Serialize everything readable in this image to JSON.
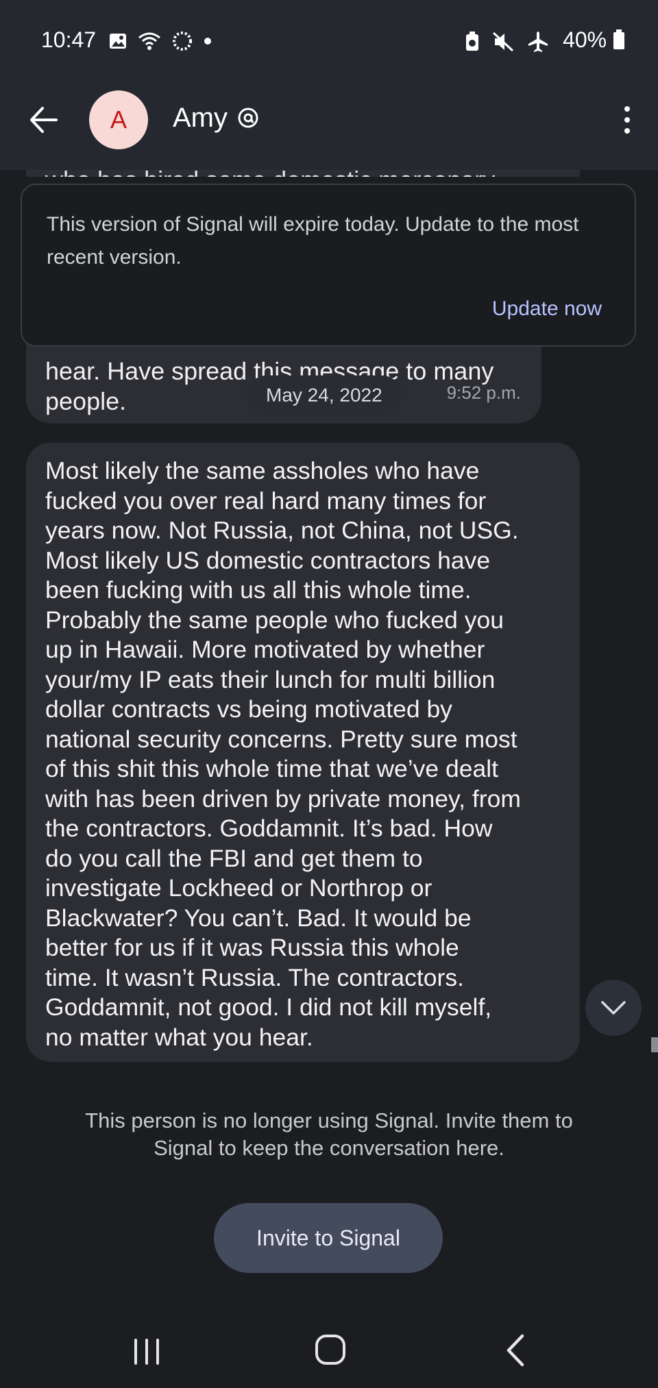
{
  "status_bar": {
    "time": "10:47",
    "battery": "40%",
    "icons_left": [
      "image-icon",
      "wifi-call-icon",
      "sync-icon",
      "dot-icon"
    ],
    "icons_right": [
      "wifi-icon",
      "battery-saver-icon",
      "mute-icon",
      "airplane-icon",
      "battery-icon"
    ]
  },
  "header": {
    "avatar_letter": "A",
    "contact_name": "Amy",
    "avatar_bg": "#f8d9d6",
    "avatar_fg": "#c41616"
  },
  "conversation": {
    "prev_message_top_fragment": "who has hired some domestic mercenary",
    "prev_message_lines": "hear. Have spread this message to many\npeople.",
    "prev_message_time": "9:52 p.m.",
    "date_separator": "May 24, 2022",
    "banner": {
      "text": "This version of Signal will expire today. Update to the most recent version.",
      "button": "Update now"
    },
    "main_message": "Most likely the same assholes who have\nfucked you over real hard many times for\nyears now. Not Russia, not China, not USG.\nMost likely US domestic contractors have\nbeen fucking with us all this whole time.\nProbably the same people who fucked you\nup in Hawaii. More motivated by whether\nyour/my IP eats their lunch for multi billion\ndollar contracts vs being motivated by\nnational security concerns. Pretty sure most\nof this shit this whole time that we’ve dealt\nwith has been driven by private money, from\nthe contractors. Goddamnit. It’s bad. How\ndo you call the FBI and get them to\ninvestigate Lockheed or Northrop or\nBlackwater? You can’t. Bad. It would be\nbetter for us if it was Russia this whole\ntime. It wasn’t Russia. The contractors.\nGoddamnit, not good. I did not kill myself,\nno matter what you hear."
  },
  "footer": {
    "note": "This person is no longer using Signal. Invite them to Signal to keep the conversation here.",
    "invite_button": "Invite to Signal"
  },
  "colors": {
    "accent_link": "#b7c3ff",
    "bubble": "#2d2e33",
    "background": "#1c1d21"
  }
}
